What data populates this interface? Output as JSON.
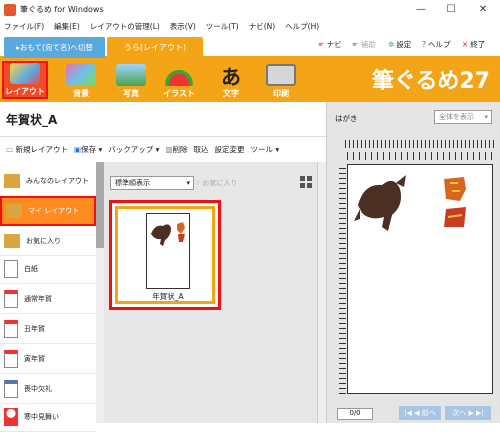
{
  "window": {
    "title": "筆ぐるめ for Windows",
    "min": "—",
    "max": "☐",
    "close": "✕"
  },
  "menu": [
    "ファイル(F)",
    "編集(E)",
    "レイアウトの管理(L)",
    "表示(V)",
    "ツール(T)",
    "ナビ(N)",
    "ヘルプ(H)"
  ],
  "tabs": {
    "front": "▸おもて(宛て名)へ切替",
    "back": "うら(レイアウト)"
  },
  "toplinks": {
    "navi": "ナビ",
    "assist": "補助",
    "settings": "設定",
    "help": "ヘルプ",
    "exit": "終了"
  },
  "tools": [
    "レイアウト",
    "背景",
    "写真",
    "イラスト",
    "文字",
    "印刷"
  ],
  "brand": "筆ぐるめ27",
  "layout_title": "年賀状_A",
  "subtools": [
    "新規レイアウト",
    "保存 ▾",
    "バックアップ ▾",
    "削除",
    "取込",
    "設定変更",
    "ツール ▾"
  ],
  "sidebar": [
    {
      "label": "みんなのレイアウト"
    },
    {
      "label": "マイ レイアウト"
    },
    {
      "label": "お気に入り"
    },
    {
      "label": "白紙"
    },
    {
      "label": "通常年賀"
    },
    {
      "label": "丑年賀"
    },
    {
      "label": "寅年賀"
    },
    {
      "label": "喪中欠礼"
    },
    {
      "label": "寒中見舞い"
    }
  ],
  "center": {
    "view": "標準順表示",
    "fav": "☆ お気に入り",
    "card_name": "年賀状_A"
  },
  "right": {
    "label": "はがき",
    "dropdown": "全体を表示",
    "page": "0/0",
    "prev": "|◀ ◀ 前へ",
    "next": "次へ ▶ ▶|"
  },
  "colors": {
    "accent": "#f4a417",
    "highlight": "#e11111",
    "selected": "#ff8a1f"
  }
}
